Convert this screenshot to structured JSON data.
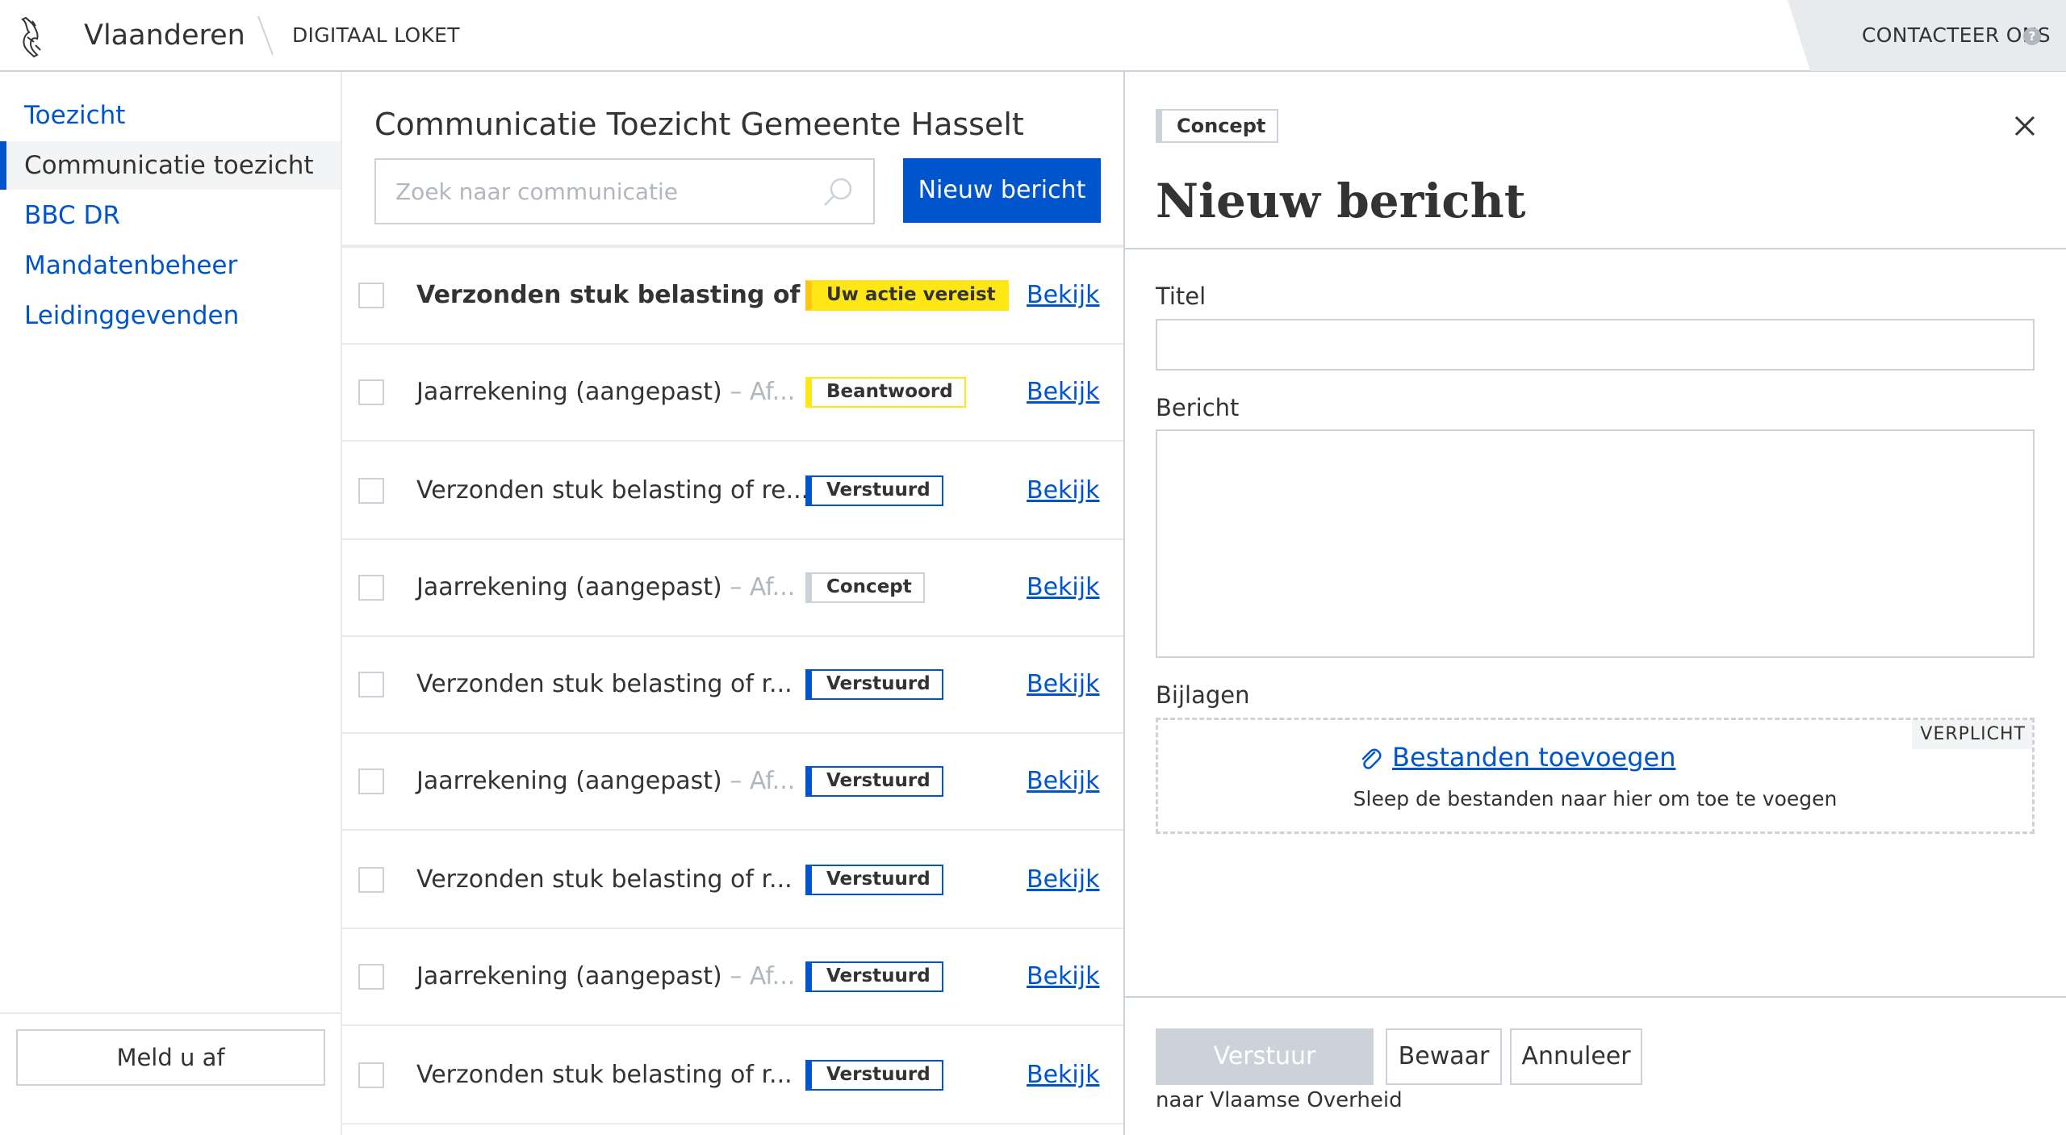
{
  "header": {
    "brand": "Vlaanderen",
    "service": "DIGITAAL LOKET",
    "contact_label": "CONTACTEER ONS",
    "contact_help": "?",
    "logo_icon": "flemish-lion-icon"
  },
  "sidebar": {
    "items": [
      {
        "label": "Toezicht",
        "active": false
      },
      {
        "label": "Communicatie toezicht",
        "active": true
      },
      {
        "label": "BBC DR",
        "active": false
      },
      {
        "label": "Mandatenbeheer",
        "active": false
      },
      {
        "label": "Leidinggevenden",
        "active": false
      }
    ],
    "logout_label": "Meld u af"
  },
  "list": {
    "title": "Communicatie Toezicht Gemeente Hasselt",
    "search_placeholder": "Zoek naar communicatie",
    "new_button": "Nieuw bericht",
    "view_label": "Bekijk",
    "rows": [
      {
        "title": "Verzonden stuk belasting of ...",
        "suffix": "",
        "bold": true,
        "status": "Uw actie vereist",
        "kind": "action"
      },
      {
        "title": "Jaarrekening (aangepast)",
        "suffix": " – Af...",
        "bold": false,
        "status": "Beantwoord",
        "kind": "answered"
      },
      {
        "title": "Verzonden stuk belasting of re...",
        "suffix": "",
        "bold": false,
        "status": "Verstuurd",
        "kind": "sent"
      },
      {
        "title": "Jaarrekening (aangepast)",
        "suffix": " – Af...",
        "bold": false,
        "status": "Concept",
        "kind": "concept"
      },
      {
        "title": "Verzonden stuk belasting of r...",
        "suffix": "",
        "bold": false,
        "status": "Verstuurd",
        "kind": "sent"
      },
      {
        "title": "Jaarrekening (aangepast)",
        "suffix": " – Af...",
        "bold": false,
        "status": "Verstuurd",
        "kind": "sent"
      },
      {
        "title": "Verzonden stuk belasting of r...",
        "suffix": "",
        "bold": false,
        "status": "Verstuurd",
        "kind": "sent"
      },
      {
        "title": "Jaarrekening (aangepast)",
        "suffix": " – Af...",
        "bold": false,
        "status": "Verstuurd",
        "kind": "sent"
      },
      {
        "title": "Verzonden stuk belasting of r...",
        "suffix": "",
        "bold": false,
        "status": "Verstuurd",
        "kind": "sent"
      }
    ]
  },
  "detail": {
    "status": "Concept",
    "title": "Nieuw bericht",
    "title_label": "Titel",
    "title_value": "",
    "message_label": "Bericht",
    "message_value": "",
    "attachments_label": "Bijlagen",
    "required_badge": "VERPLICHT",
    "add_files": "Bestanden toevoegen",
    "drop_hint": "Sleep de bestanden naar hier om toe te voegen",
    "send_button": "Verstuur",
    "save_button": "Bewaar",
    "cancel_button": "Annuleer",
    "send_hint": "naar Vlaamse Overheid"
  },
  "colors": {
    "primary": "#0055cc",
    "action_yellow": "#ffe615",
    "border": "#cbd2da",
    "text": "#333332",
    "muted": "#b0b7bf"
  }
}
